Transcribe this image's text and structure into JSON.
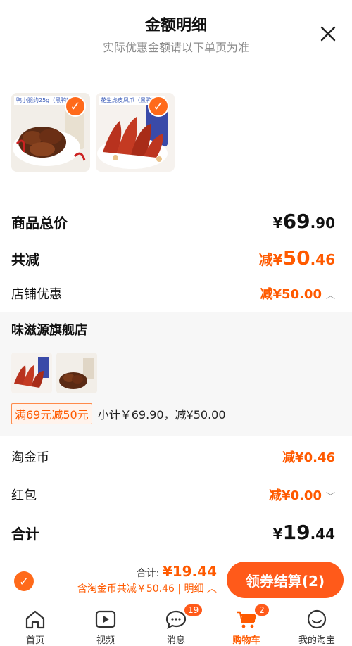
{
  "header": {
    "title": "金额明细",
    "subtitle": "实际优惠金额请以下单页为准"
  },
  "products": [
    {
      "banner": "鸭小腿约25g（黑鸭味）"
    },
    {
      "banner": "花生虎皮凤爪（黑鸭味）"
    }
  ],
  "summary": {
    "goods_total_label": "商品总价",
    "goods_total_currency": "¥",
    "goods_total_int": "69",
    "goods_total_dec": ".90",
    "total_discount_label": "共减",
    "total_discount_prefix": "减¥",
    "total_discount_int": "50",
    "total_discount_dec": ".46",
    "shop_discount_label": "店铺优惠",
    "shop_discount_value": "减¥50.00"
  },
  "shop": {
    "name": "味滋源旗舰店",
    "promo_tag": "满69元减50元",
    "promo_subtotal": "小计￥69.90，减¥50.00"
  },
  "extra": {
    "coins_label": "淘金币",
    "coins_value": "减¥0.46",
    "redpacket_label": "红包",
    "redpacket_value": "减¥0.00",
    "sum_label": "合计",
    "sum_currency": "¥",
    "sum_int": "19",
    "sum_dec": ".44"
  },
  "bottom": {
    "total_label": "合计:",
    "total_value": "¥19.44",
    "detail_text": "含淘金币共减￥50.46 | 明细",
    "checkout_label": "领券结算(2)"
  },
  "tabbar": [
    {
      "label": "首页",
      "icon": "home-icon"
    },
    {
      "label": "视频",
      "icon": "video-icon"
    },
    {
      "label": "消息",
      "icon": "message-icon",
      "badge": "19"
    },
    {
      "label": "购物车",
      "icon": "cart-icon",
      "badge": "2"
    },
    {
      "label": "我的淘宝",
      "icon": "profile-icon"
    }
  ],
  "colors": {
    "accent": "#ff5a00",
    "button": "#ff5a1a"
  }
}
